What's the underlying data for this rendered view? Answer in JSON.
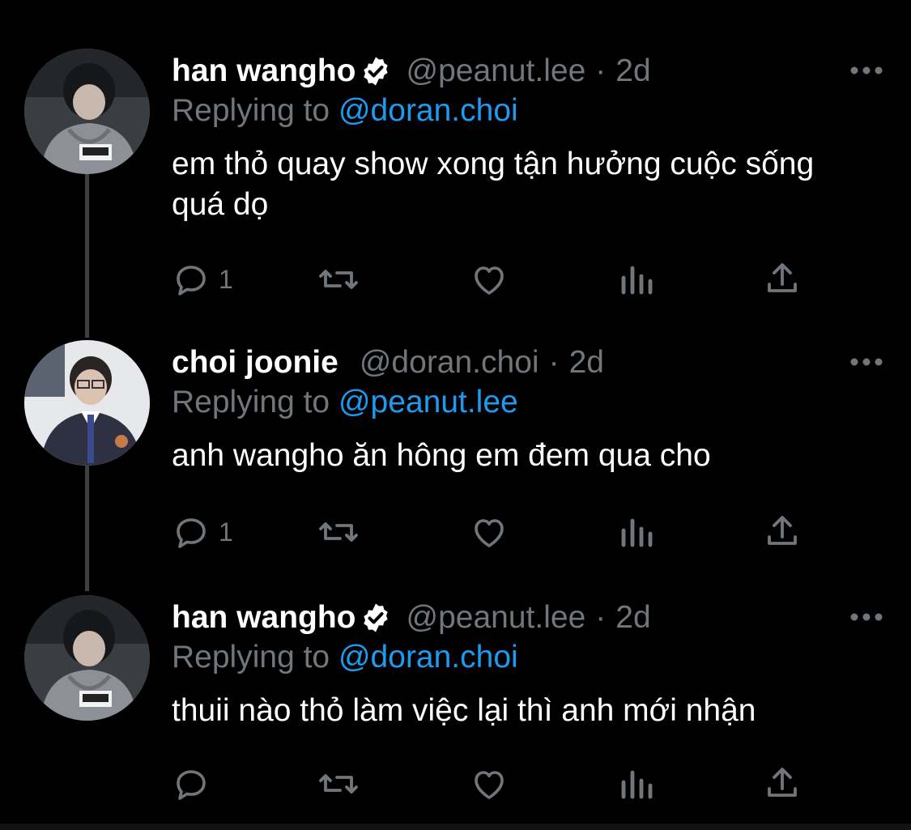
{
  "colors": {
    "background": "#000000",
    "name": "#ffffff",
    "muted": "#71767b",
    "mention": "#1d9bf0",
    "thread_line": "#3e4144"
  },
  "tweets": [
    {
      "display_name": "han wangho",
      "verified": true,
      "handle": "@peanut.lee",
      "separator": "·",
      "time": "2d",
      "replying_prefix": "Replying to",
      "replying_to": "@doran.choi",
      "text": "em thỏ quay show xong tận hưởng cuộc sống quá dọ",
      "reply_count": "1",
      "more_icon": "more-horizontal-icon"
    },
    {
      "display_name": "choi joonie",
      "verified": false,
      "handle": "@doran.choi",
      "separator": "·",
      "time": "2d",
      "replying_prefix": "Replying to",
      "replying_to": "@peanut.lee",
      "text": "anh wangho ăn hông em đem qua cho",
      "reply_count": "1",
      "more_icon": "more-horizontal-icon"
    },
    {
      "display_name": "han wangho",
      "verified": true,
      "handle": "@peanut.lee",
      "separator": "·",
      "time": "2d",
      "replying_prefix": "Replying to",
      "replying_to": "@doran.choi",
      "text": "thuii nào thỏ làm việc lại thì anh mới nhận",
      "reply_count": "",
      "more_icon": "more-horizontal-icon"
    }
  ],
  "action_icons": [
    "reply-icon",
    "retweet-icon",
    "like-icon",
    "views-icon",
    "share-icon"
  ]
}
